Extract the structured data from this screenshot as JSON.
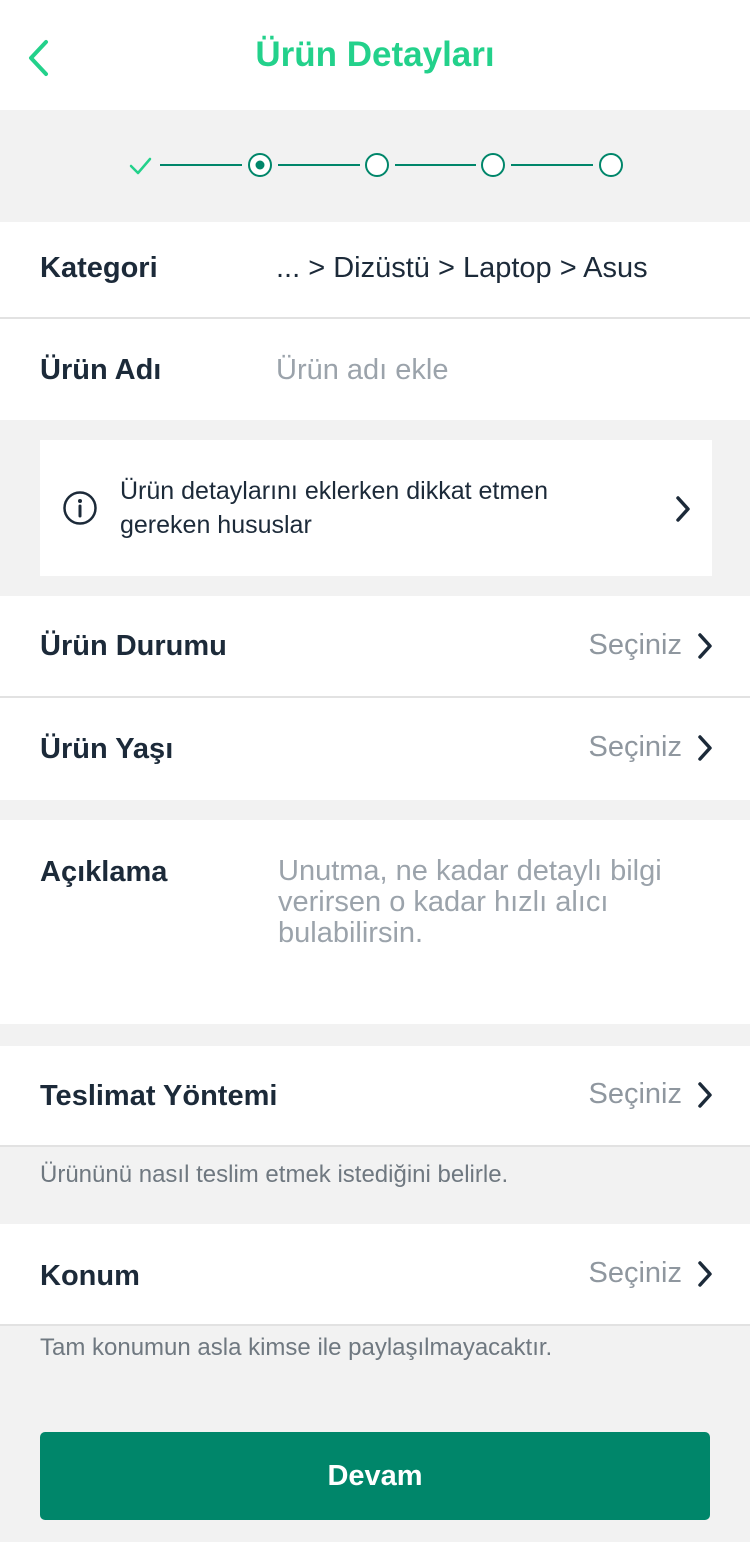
{
  "header": {
    "title": "Ürün Detayları",
    "back_icon": "chevron-left-icon"
  },
  "stepper": {
    "total_steps": 5,
    "current_step": 2,
    "completed_steps": 1,
    "color": "#00866a"
  },
  "kategori": {
    "label": "Kategori",
    "value": "... > Dizüstü > Laptop > Asus"
  },
  "urun_adi": {
    "label": "Ürün Adı",
    "placeholder": "Ürün adı ekle"
  },
  "info_card": {
    "icon": "info-icon",
    "text": "Ürün detaylarını eklerken dikkat etmen gereken hususlar"
  },
  "urun_durumu": {
    "label": "Ürün Durumu",
    "value": "Seçiniz"
  },
  "urun_yasi": {
    "label": "Ürün Yaşı",
    "value": "Seçiniz"
  },
  "aciklama": {
    "label": "Açıklama",
    "placeholder": "Unutma, ne kadar detaylı bilgi verirsen o kadar hızlı alıcı bulabilirsin."
  },
  "teslimat": {
    "label": "Teslimat Yöntemi",
    "value": "Seçiniz",
    "hint": "Ürününü nasıl teslim etmek istediğini belirle."
  },
  "konum": {
    "label": "Konum",
    "value": "Seçiniz",
    "hint": "Tam konumun asla kimse ile paylaşılmayacaktır."
  },
  "devam_button": {
    "label": "Devam"
  },
  "colors": {
    "title": "#23d18b",
    "primary": "#00866a",
    "background": "#f2f2f2"
  }
}
